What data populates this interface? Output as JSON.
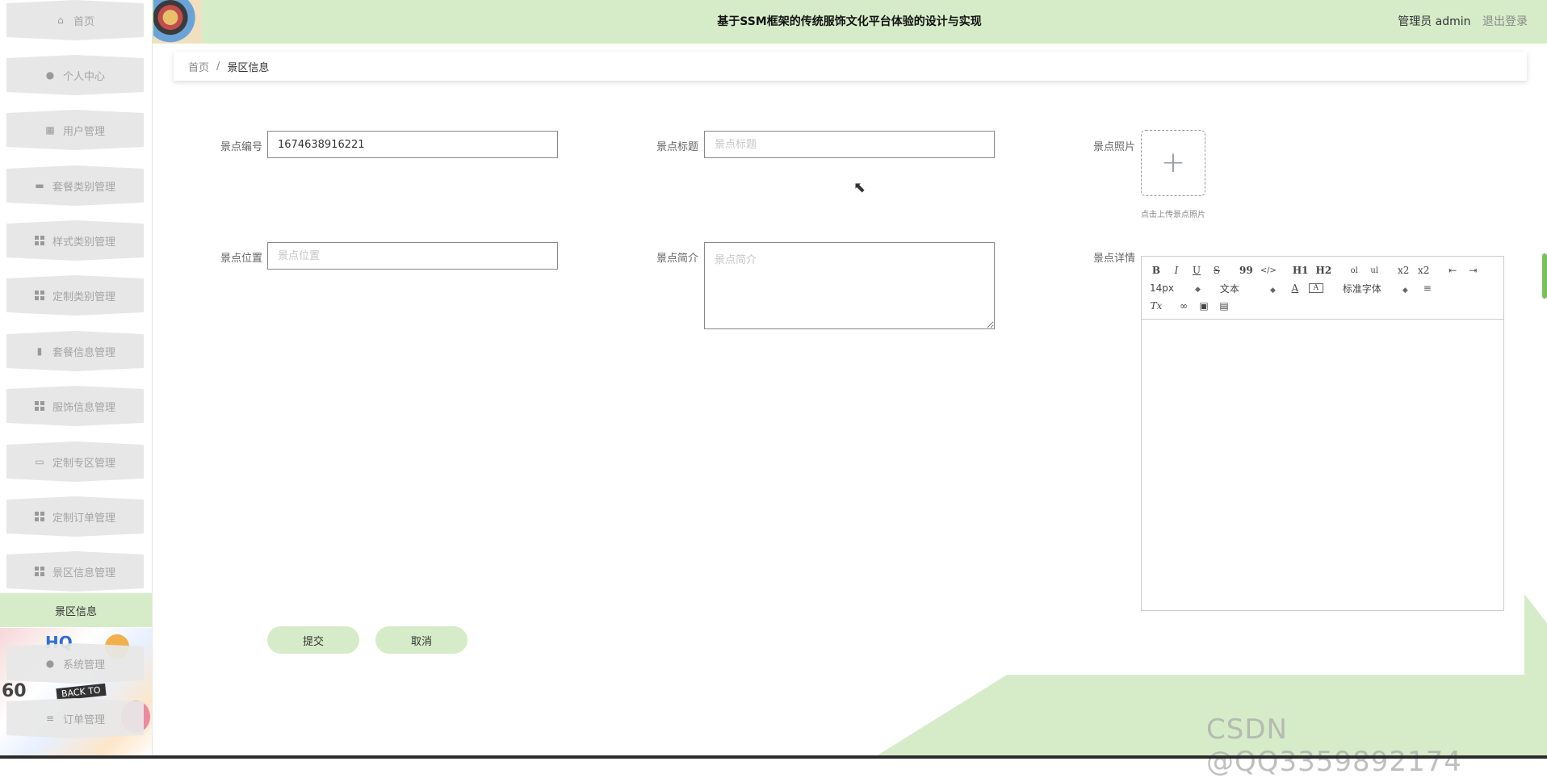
{
  "header": {
    "title": "基于SSM框架的传统服饰文化平台体验的设计与实现",
    "user_label": "管理员 admin",
    "logout_label": "退出登录"
  },
  "sidebar": {
    "items": [
      {
        "label": "首页",
        "icon": "home-icon"
      },
      {
        "label": "个人中心",
        "icon": "user-icon"
      },
      {
        "label": "用户管理",
        "icon": "grid-icon"
      },
      {
        "label": "套餐类别管理",
        "icon": "briefcase-icon"
      },
      {
        "label": "样式类别管理",
        "icon": "grid-icon"
      },
      {
        "label": "定制类别管理",
        "icon": "grid-icon"
      },
      {
        "label": "套餐信息管理",
        "icon": "clipboard-icon"
      },
      {
        "label": "服饰信息管理",
        "icon": "grid-icon"
      },
      {
        "label": "定制专区管理",
        "icon": "monitor-icon"
      },
      {
        "label": "定制订单管理",
        "icon": "grid-icon"
      },
      {
        "label": "景区信息管理",
        "icon": "grid-icon"
      },
      {
        "label": "系统管理",
        "icon": "location-icon"
      },
      {
        "label": "订单管理",
        "icon": "list-icon"
      }
    ],
    "active_submenu": "景区信息",
    "deco_text_1": "HQ",
    "deco_text_2": "BACK TO",
    "deco_text_3": "60"
  },
  "breadcrumb": {
    "home": "首页",
    "separator": "/",
    "current": "景区信息"
  },
  "form": {
    "number_label": "景点编号",
    "number_value": "1674638916221",
    "title_label": "景点标题",
    "title_placeholder": "景点标题",
    "photo_label": "景点照片",
    "photo_tip": "点击上传景点照片",
    "location_label": "景点位置",
    "location_placeholder": "景点位置",
    "intro_label": "景点简介",
    "intro_placeholder": "景点简介",
    "detail_label": "景点详情"
  },
  "editor": {
    "toolbar_row1": [
      "B",
      "I",
      "U",
      "S",
      "99",
      "</>",
      "H1",
      "H2",
      "ol",
      "ul",
      "x2",
      "x2"
    ],
    "font_size": "14px",
    "text_type": "文本",
    "font_family": "标准字体",
    "clear_format": "Tx"
  },
  "buttons": {
    "submit": "提交",
    "cancel": "取消"
  },
  "watermark": "CSDN @QQ3359892174",
  "colors": {
    "accent": "#d6ecc9",
    "sidebar_item": "#e7e7e7"
  }
}
